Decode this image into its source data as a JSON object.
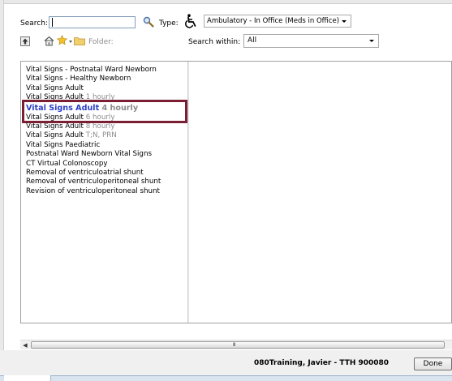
{
  "search": {
    "label": "Search:",
    "value": "",
    "type_label": "Type:",
    "type_value": "Ambulatory - In Office (Meds in Office)"
  },
  "folder": {
    "label": "Folder:",
    "within_label": "Search within:",
    "within_value": "All"
  },
  "results": [
    {
      "name": "Vital Signs  - Postnatal Ward Newborn",
      "freq": ""
    },
    {
      "name": "Vital Signs - Healthy Newborn",
      "freq": ""
    },
    {
      "name": "Vital Signs Adult",
      "freq": ""
    },
    {
      "name": "Vital Signs Adult",
      "freq": "1 hourly"
    },
    {
      "name": "Vital Signs Adult",
      "freq": "4 hourly"
    },
    {
      "name": "Vital Signs Adult",
      "freq": "6 hourly"
    },
    {
      "name": "Vital Signs Adult",
      "freq": "8 hourly"
    },
    {
      "name": "Vital Signs Adult",
      "freq": "T;N, PRN"
    },
    {
      "name": "Vital Signs Paediatric",
      "freq": ""
    },
    {
      "name": "Postnatal Ward Newborn Vital Signs",
      "freq": ""
    },
    {
      "name": "CT Virtual Colonoscopy",
      "freq": ""
    },
    {
      "name": "Removal of ventriculoatrial shunt",
      "freq": ""
    },
    {
      "name": "Removal of ventriculoperitoneal shunt",
      "freq": ""
    },
    {
      "name": "Revision of ventriculoperitoneal shunt",
      "freq": ""
    }
  ],
  "selected_index": 4,
  "scrollbar": {
    "grip": "III"
  },
  "footer": {
    "user_info": "080Training, Javier - TTH 900080",
    "done_label": "Done"
  },
  "colors": {
    "selected_text": "#2a3fc4",
    "highlight_border": "#7a1f33",
    "frequency_text": "#8c8c8c"
  }
}
